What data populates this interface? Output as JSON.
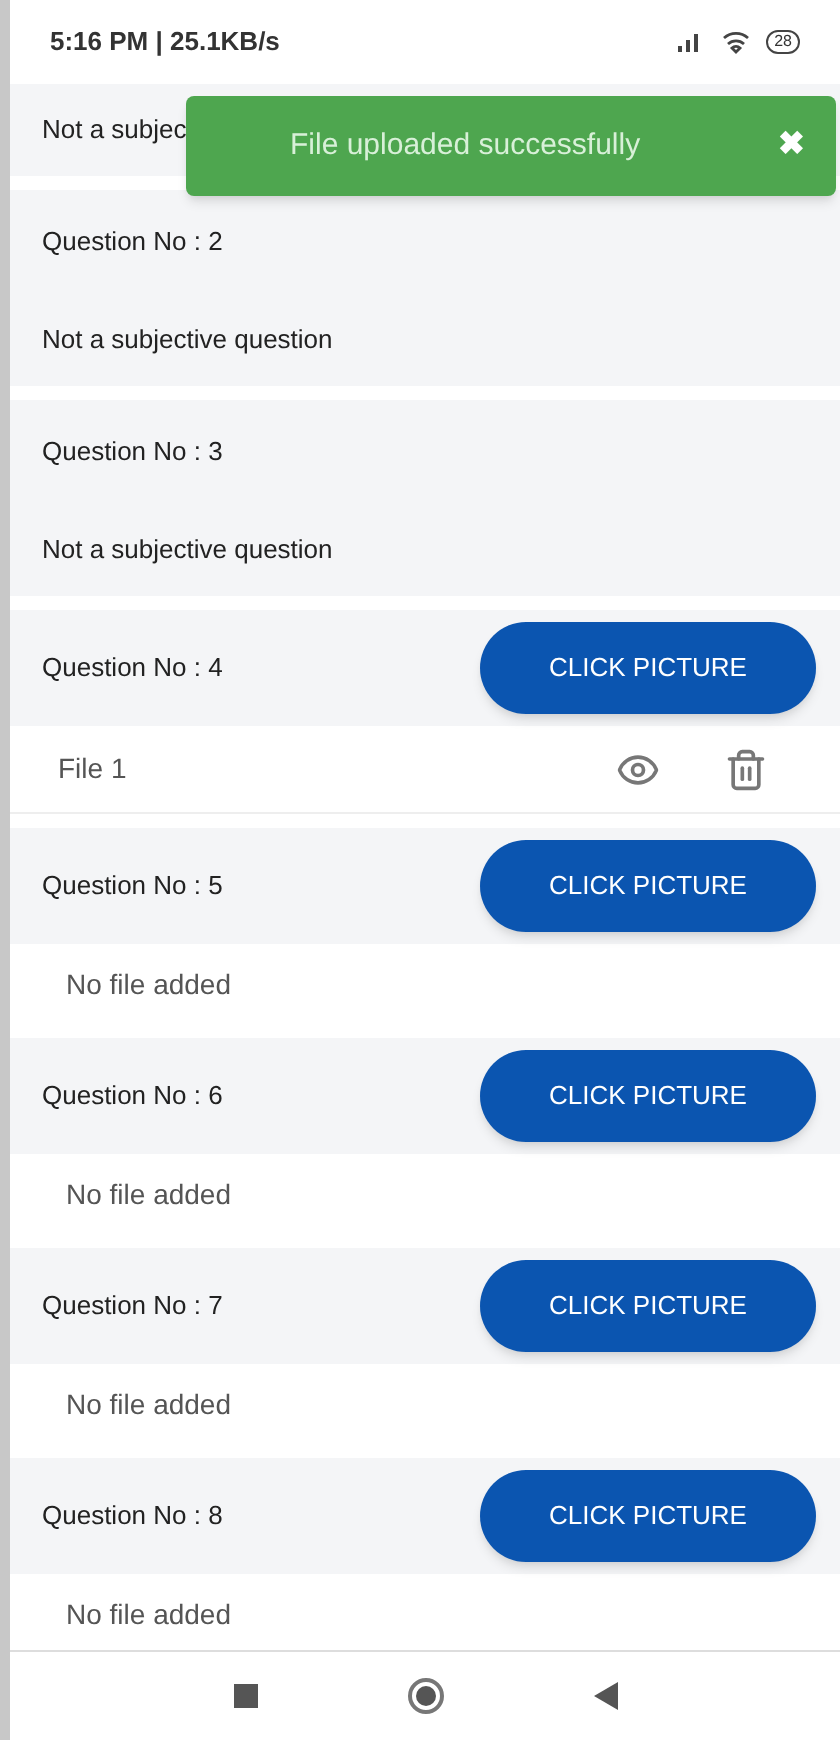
{
  "status_bar": {
    "time": "5:16 PM | 25.1KB/s",
    "battery": "28"
  },
  "toast": {
    "message": "File uploaded successfully",
    "close": "✖"
  },
  "questions": [
    {
      "kind": "text",
      "body": "Not a subjec"
    },
    {
      "kind": "text",
      "title": "Question No : 2",
      "body": "Not a subjective question"
    },
    {
      "kind": "text",
      "title": "Question No : 3",
      "body": "Not a subjective question"
    },
    {
      "kind": "upload",
      "title": "Question No : 4",
      "button": "CLICK PICTURE",
      "files": [
        "File 1"
      ]
    },
    {
      "kind": "upload",
      "title": "Question No : 5",
      "button": "CLICK PICTURE",
      "empty": "No file added"
    },
    {
      "kind": "upload",
      "title": "Question No : 6",
      "button": "CLICK PICTURE",
      "empty": "No file added"
    },
    {
      "kind": "upload",
      "title": "Question No : 7",
      "button": "CLICK PICTURE",
      "empty": "No file added"
    },
    {
      "kind": "upload",
      "title": "Question No : 8",
      "button": "CLICK PICTURE",
      "empty": "No file added"
    }
  ]
}
